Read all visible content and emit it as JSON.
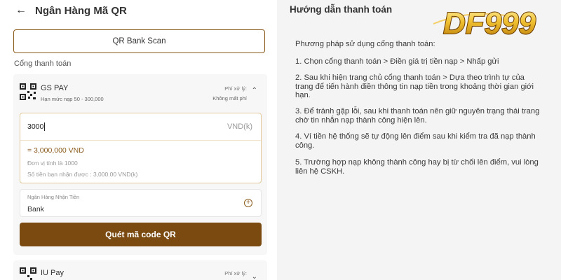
{
  "header": {
    "back_icon": "arrow-left-icon",
    "title": "Ngân Hàng Mã QR"
  },
  "scan_button": {
    "label": "QR Bank Scan"
  },
  "section": {
    "label": "Cổng thanh toán"
  },
  "gateways": [
    {
      "name": "GS PAY",
      "limit": "Hạn mức nạp 50 - 300,000",
      "fee_label": "Phí xử lý:",
      "fee_value": "Không mất phí",
      "icon": "qr-code-icon"
    },
    {
      "name": "IU Pay",
      "fee_label": "Phí xử lý:",
      "icon": "qr-code-icon"
    }
  ],
  "amount": {
    "value": "3000",
    "unit": "VND(k)",
    "converted": "= 3,000,000 VND",
    "unit_note": "Đơn vị tính là 1000",
    "receive_note": "Số tiền bạn nhận được : 3,000.00 VND(k)"
  },
  "bank": {
    "label": "Ngân Hàng Nhận Tiền",
    "value": "Bank",
    "icon": "plus-circle-icon"
  },
  "submit_button": {
    "label": "Quét mã code QR"
  },
  "guide": {
    "title": "Hướng dẫn thanh toán",
    "intro": "Phương pháp sử dụng cổng thanh toán:",
    "steps": [
      "1. Chọn cổng thanh toán > Điền giá trị tiền nạp > Nhấp gửi",
      "2. Sau khi hiện trang chủ cổng thanh toán > Dựa theo trình tự của trang để tiến hành điền thông tin nạp tiền trong khoảng thời gian giới hạn.",
      "3. Để tránh gặp lỗi, sau khi thanh toán nên giữ nguyên trạng thái trang chờ tin nhắn nạp thành công hiện lên.",
      "4. Ví tiền hệ thống sẽ tự động lên điểm sau khi kiểm tra đã nạp thành công.",
      "5. Trường hợp nạp không thành công hay bị từ chối lên điểm, vui lòng liên hệ CSKH."
    ]
  },
  "logo": {
    "text": "DF999"
  },
  "colors": {
    "accent": "#7a4a10",
    "border_accent": "#8a5a1c",
    "logo_gold": "#e8b020"
  }
}
